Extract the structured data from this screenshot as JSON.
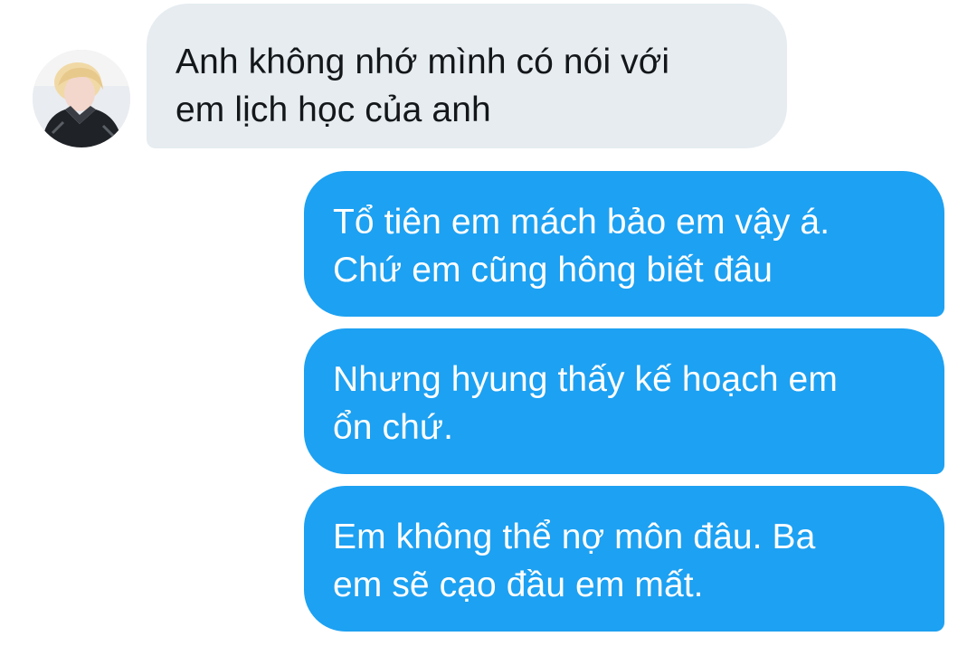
{
  "conversation": {
    "received": [
      {
        "lines": [
          "Anh không nhớ mình có nói với",
          "em lịch học của anh"
        ]
      }
    ],
    "sent": [
      {
        "lines": [
          "Tổ tiên em mách bảo em vậy á.",
          "Chứ em cũng hông biết đâu"
        ]
      },
      {
        "lines": [
          "Nhưng hyung thấy kế hoạch em",
          "ổn chứ."
        ]
      },
      {
        "lines": [
          "Em không thể nợ môn đâu. Ba",
          "em sẽ cạo đầu em mất."
        ]
      }
    ]
  },
  "colors": {
    "received_bubble": "#e6ecf0",
    "sent_bubble": "#1da1f2",
    "received_text": "#14171a",
    "sent_text": "#ffffff"
  }
}
